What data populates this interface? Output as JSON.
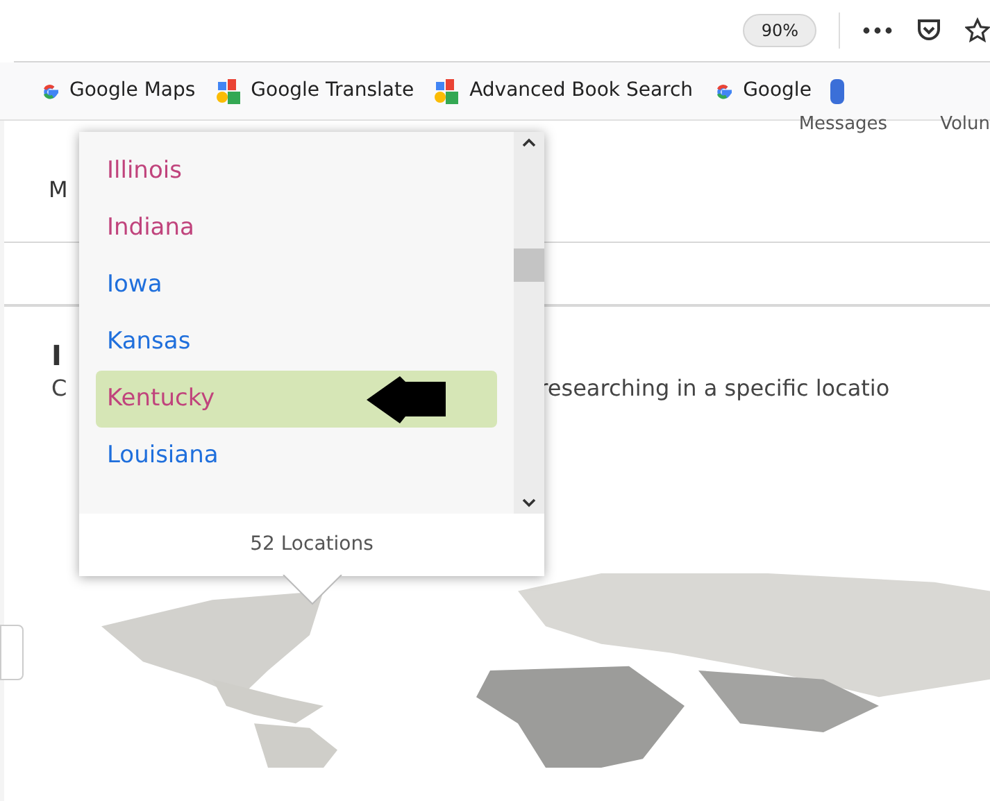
{
  "toolbar": {
    "zoom": "90%"
  },
  "bookmarks": [
    {
      "label": "Google Maps",
      "kind": "g"
    },
    {
      "label": "Google Translate",
      "kind": "blocks"
    },
    {
      "label": "Advanced Book Search",
      "kind": "blocks"
    },
    {
      "label": "Google",
      "kind": "g"
    }
  ],
  "page": {
    "nav": [
      "Messages",
      "Volun"
    ],
    "tab_fragment": "M",
    "heading_fragment": "I",
    "text_fragment": "C",
    "text": "researching in a specific locatio"
  },
  "locations": {
    "items": [
      {
        "label": "Illinois",
        "color": "#c0437c",
        "selected": false
      },
      {
        "label": "Indiana",
        "color": "#c0437c",
        "selected": false
      },
      {
        "label": "Iowa",
        "color": "#1f6fdc",
        "selected": false
      },
      {
        "label": "Kansas",
        "color": "#1f6fdc",
        "selected": false
      },
      {
        "label": "Kentucky",
        "color": "#c0437c",
        "selected": true
      },
      {
        "label": "Louisiana",
        "color": "#1f6fdc",
        "selected": false
      }
    ],
    "footer": "52 Locations"
  }
}
